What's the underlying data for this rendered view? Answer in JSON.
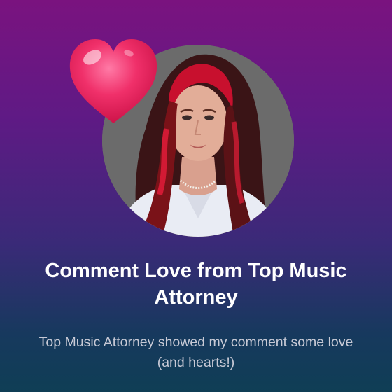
{
  "post": {
    "title": "Comment Love from Top Music Attorney",
    "subtitle": "Top Music Attorney showed my comment some love (and hearts!)"
  },
  "icons": {
    "reaction": "heart-icon"
  },
  "colors": {
    "background_top": "#7a137f",
    "background_bottom": "#0f3e55",
    "heart": "#f0306a",
    "title_text": "#ffffff",
    "subtitle_text": "#c8cad6"
  }
}
